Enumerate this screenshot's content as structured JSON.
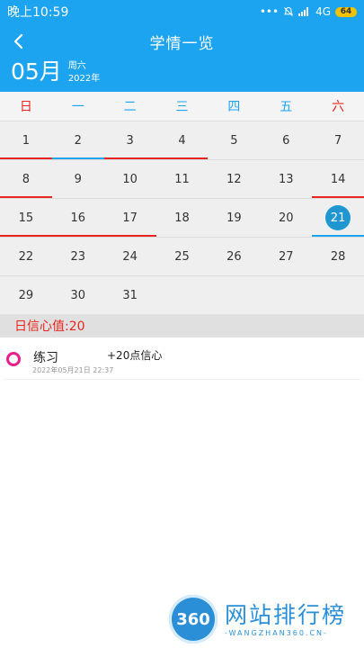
{
  "status": {
    "time": "晚上10:59",
    "dots": "•••",
    "network": "4G",
    "battery": "64"
  },
  "header": {
    "title": "学情一览"
  },
  "datebar": {
    "month": "05月",
    "weekday": "周六",
    "year": "2022年"
  },
  "weekdays": [
    {
      "label": "日",
      "color": "#e8261e"
    },
    {
      "label": "一",
      "color": "#1ca4f0"
    },
    {
      "label": "二",
      "color": "#1ca4f0"
    },
    {
      "label": "三",
      "color": "#1ca4f0"
    },
    {
      "label": "四",
      "color": "#1ca4f0"
    },
    {
      "label": "五",
      "color": "#1ca4f0"
    },
    {
      "label": "六",
      "color": "#e8261e"
    }
  ],
  "calendar": {
    "weeks": [
      [
        {
          "d": "1",
          "bar": "red"
        },
        {
          "d": "2",
          "bar": "blue"
        },
        {
          "d": "3",
          "bar": "red"
        },
        {
          "d": "4",
          "bar": "red"
        },
        {
          "d": "5"
        },
        {
          "d": "6"
        },
        {
          "d": "7"
        }
      ],
      [
        {
          "d": "8",
          "bar": "red"
        },
        {
          "d": "9"
        },
        {
          "d": "10"
        },
        {
          "d": "11"
        },
        {
          "d": "12"
        },
        {
          "d": "13"
        },
        {
          "d": "14",
          "bar": "red"
        }
      ],
      [
        {
          "d": "15",
          "bar": "red"
        },
        {
          "d": "16",
          "bar": "red"
        },
        {
          "d": "17",
          "bar": "red"
        },
        {
          "d": "18"
        },
        {
          "d": "19"
        },
        {
          "d": "20"
        },
        {
          "d": "21",
          "bar": "blue",
          "selected": true
        }
      ],
      [
        {
          "d": "22"
        },
        {
          "d": "23"
        },
        {
          "d": "24"
        },
        {
          "d": "25"
        },
        {
          "d": "26"
        },
        {
          "d": "27"
        },
        {
          "d": "28"
        }
      ],
      [
        {
          "d": "29"
        },
        {
          "d": "30"
        },
        {
          "d": "31"
        },
        {
          "d": ""
        },
        {
          "d": ""
        },
        {
          "d": ""
        },
        {
          "d": ""
        }
      ]
    ],
    "bar_colors": {
      "red": "#e8261e",
      "blue": "#1ca4f0"
    }
  },
  "score": {
    "label": "日信心值:20"
  },
  "records": [
    {
      "title": "练习",
      "time": "2022年05月21日 22:37",
      "points": "+20点信心"
    }
  ],
  "watermark": {
    "logo": "360",
    "main": "网站排行榜",
    "sub": "-WANGZHAN360.CN-"
  }
}
